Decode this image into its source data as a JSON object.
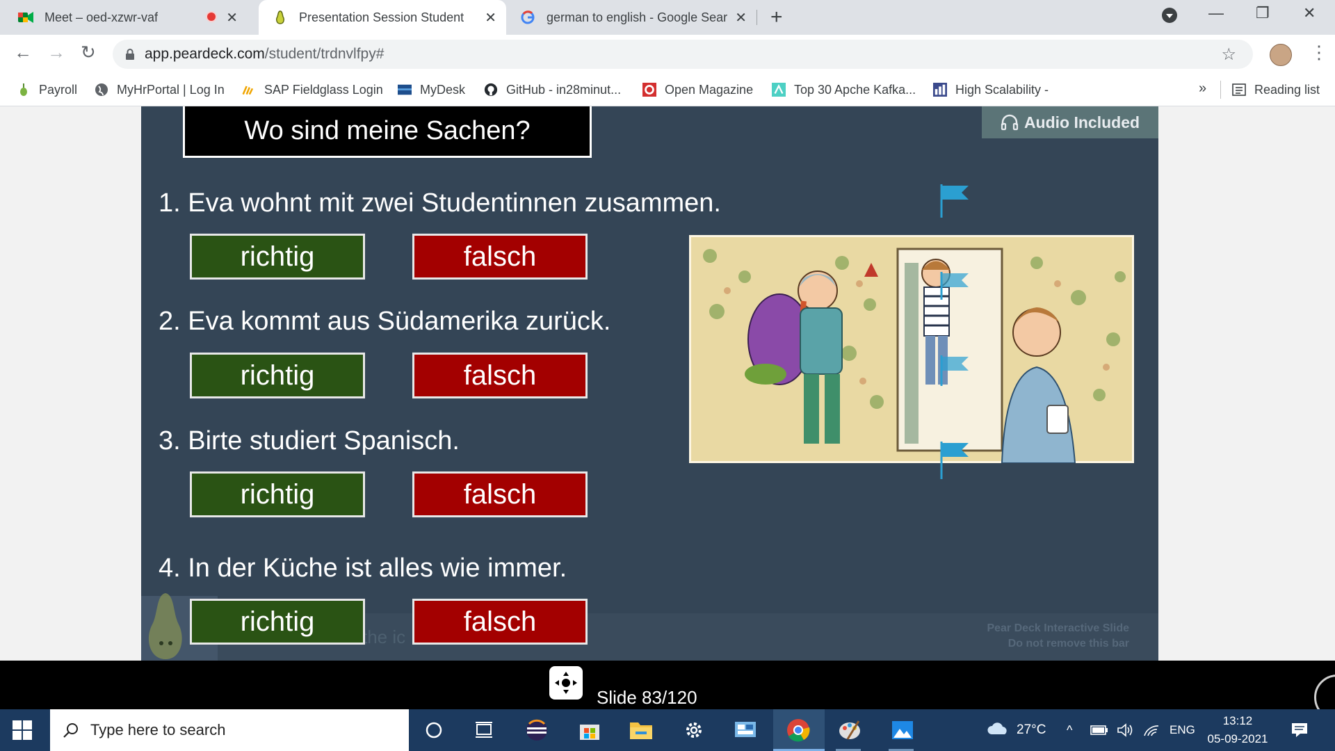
{
  "browser": {
    "tabs": [
      {
        "title": "Meet – oed-xzwr-vaf",
        "icon": "google-meet-icon"
      },
      {
        "title": "Presentation Session Student",
        "icon": "pear-deck-icon"
      },
      {
        "title": "german to english - Google Sear",
        "icon": "google-icon"
      }
    ],
    "new_tab": "+",
    "address": {
      "domain": "app.peardeck.com",
      "path": "/student/trdnvlfpy#"
    },
    "bookmarks": [
      {
        "label": "Payroll",
        "icon": "payroll-icon"
      },
      {
        "label": "MyHrPortal | Log In",
        "icon": "globe-icon"
      },
      {
        "label": "SAP Fieldglass Login",
        "icon": "fieldglass-icon"
      },
      {
        "label": "MyDesk",
        "icon": "mydesk-icon"
      },
      {
        "label": "GitHub - in28minut...",
        "icon": "github-icon"
      },
      {
        "label": "Open Magazine",
        "icon": "open-magazine-icon"
      },
      {
        "label": "Top 30 Apche Kafka...",
        "icon": "kafka-icon"
      },
      {
        "label": "High Scalability -",
        "icon": "high-scalability-icon"
      }
    ],
    "bookmarks_more": "»",
    "reading_list": "Reading list"
  },
  "slide": {
    "title": "Wo sind meine Sachen?",
    "audio_badge": "Audio Included",
    "questions": [
      {
        "text": "1. Eva wohnt mit zwei Studentinnen zusammen.",
        "true_label": "richtig",
        "false_label": "falsch"
      },
      {
        "text": "2. Eva kommt aus Südamerika zurück.",
        "true_label": "richtig",
        "false_label": "falsch"
      },
      {
        "text": "3. Birte studiert Spanisch.",
        "true_label": "richtig",
        "false_label": "falsch"
      },
      {
        "text": "4. In der Küche ist alles wie immer.",
        "true_label": "richtig",
        "false_label": "falsch"
      }
    ],
    "footer_text_faded": "the ic",
    "peardeck_bar": {
      "line1": "Pear Deck Interactive Slide",
      "line2": "Do not remove this bar"
    },
    "counter": "Slide 83/120"
  },
  "taskbar": {
    "search_placeholder": "Type here to search",
    "weather": "27°C",
    "language": "ENG",
    "time": "13:12",
    "date": "05-09-2021"
  },
  "colors": {
    "slide_bg": "#344556",
    "richtig_bg": "#2a5314",
    "falsch_bg": "#a30000",
    "flag": "#2b9fd1"
  }
}
